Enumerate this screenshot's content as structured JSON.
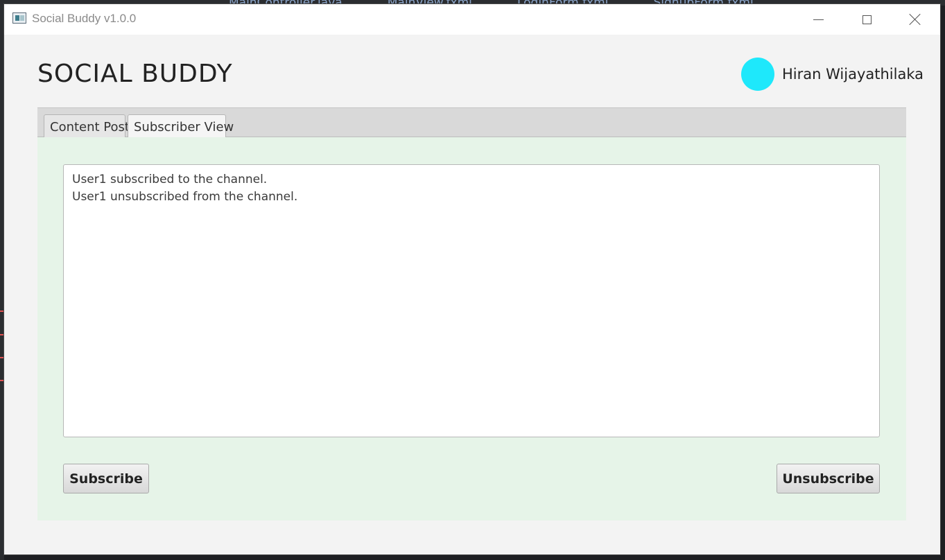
{
  "window": {
    "title": "Social Buddy v1.0.0"
  },
  "header": {
    "app_title": "SOCIAL BUDDY",
    "user_name": "Hiran Wijayathilaka",
    "avatar_color": "#1ee8fb"
  },
  "tabs": [
    {
      "label": "Content Post",
      "selected": false
    },
    {
      "label": "Subscriber View",
      "selected": true
    }
  ],
  "subscriber_view": {
    "log_lines": [
      "User1 subscribed to the channel.",
      "User1 unsubscribed from the channel."
    ],
    "subscribe_label": "Subscribe",
    "unsubscribe_label": "Unsubscribe"
  },
  "background_ide": {
    "tabs": [
      "MainController.java",
      "MainView.fxml",
      "LoginForm.fxml",
      "SignupForm.fxml"
    ]
  },
  "colors": {
    "tab_body_bg": "#e6f4e8",
    "window_bg": "#f3f3f3"
  }
}
